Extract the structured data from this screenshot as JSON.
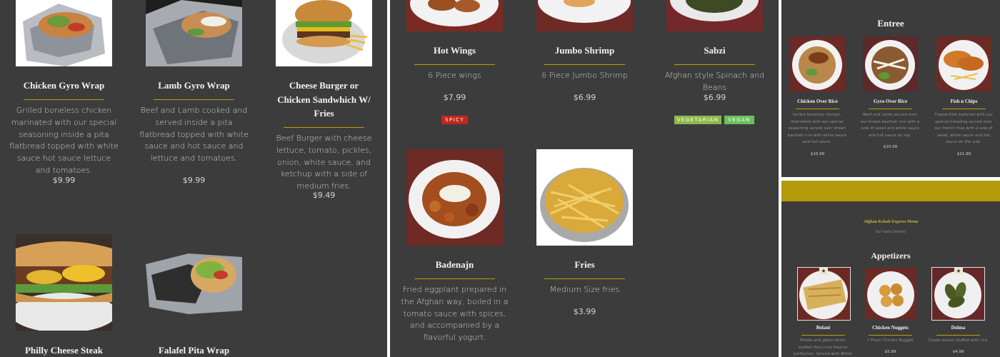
{
  "panel1": {
    "items": [
      {
        "name": "Chicken Gyro Wrap",
        "description": "Grilled boneless chicken marinated with our special seasoning inside a pita flatbread topped with white sauce hot sauce lettuce and tomatoes.",
        "price": "$9.99",
        "image": "chicken-gyro-wrap-photo"
      },
      {
        "name": "Lamb Gyro Wrap",
        "description": "Beef and Lamb cooked and served inside a pita flatbread topped with white sauce and hot sauce and lettuce and tomatoes.",
        "price": "$9.99",
        "image": "lamb-gyro-wrap-photo"
      },
      {
        "name": "Cheese Burger or Chicken Sandwhich W/ Fries",
        "description": "Beef Burger with cheese lettuce, tomato, pickles, onion, white sauce, and ketchup with a side of medium fries.",
        "price": "$9.49",
        "image": "cheese-burger-photo"
      },
      {
        "name": "Philly Cheese Steak",
        "image": "philly-cheese-steak-photo"
      },
      {
        "name": "Falafel Pita Wrap",
        "image": "falafel-pita-wrap-photo"
      }
    ]
  },
  "panel2": {
    "items": [
      {
        "name": "Hot Wings",
        "description": "6 Piece wings",
        "price": "$7.99",
        "tags": [
          "SPICY"
        ],
        "image": "hot-wings-photo"
      },
      {
        "name": "Jumbo Shrimp",
        "description": "6 Piece Jumbo Shrimp",
        "price": "$6.99",
        "image": "jumbo-shrimp-photo"
      },
      {
        "name": "Sabzi",
        "description": "Afghan style Spinach and Beans",
        "price": "$6.99",
        "tags": [
          "VEGETARIAN",
          "VEGAN"
        ],
        "image": "sabzi-photo"
      },
      {
        "name": "Badenajn",
        "description": "Fried eggplant prepared in the Afghan way, boiled in a tomato sauce with spices, and accompanied by a flavorful yogurt.",
        "image": "badenajn-photo"
      },
      {
        "name": "Fries",
        "description": "Medium Size fries",
        "price": "$3.99",
        "image": "fries-photo"
      }
    ],
    "tag_colors": {
      "SPICY": "#c0281c",
      "VEGETARIAN": "#8fb84a",
      "VEGAN": "#6cbf5b"
    }
  },
  "panel3": {
    "section_title": "Entree",
    "items": [
      {
        "name": "Chicken Over Rice",
        "description": "Grilled boneless chicken, marinated with our special seasoning served over brown basmati rice with white sauce and hot sauce.",
        "price": "$10.99"
      },
      {
        "name": "Gyro Over Rice",
        "description": "Beef and Lamb served over our brown basmati rice with a side of salad and white sauce and hot sauce on top.",
        "price": "$10.99"
      },
      {
        "name": "Fish n Chips",
        "description": "Tilapia fillet buttered with our special breading served over our french fries with a side of salad, white sauce and hot sauce on the side.",
        "price": "$11.99"
      }
    ]
  },
  "panel4": {
    "menu_title": "Afghan Kabab Express Menu",
    "menu_subtitle": "Our tasty Dishes!",
    "section_title": "Appetizers",
    "header_bar_color": "#b39b0a",
    "items": [
      {
        "name": "Bolani",
        "description": "Potato and green onion stuffed thin-crust fried to perfection. Served with White sauce and",
        "featured": true
      },
      {
        "name": "Chicken Nuggets",
        "description": "7 Piece Chicken Nugget",
        "price": "$5.99",
        "featured": false
      },
      {
        "name": "Dolma",
        "description": "Grape leaves stuffed with rice",
        "price": "$4.99",
        "featured": true
      }
    ]
  },
  "theme": {
    "accent": "#b5a10a",
    "panel_bg": "#3c3c3c"
  }
}
